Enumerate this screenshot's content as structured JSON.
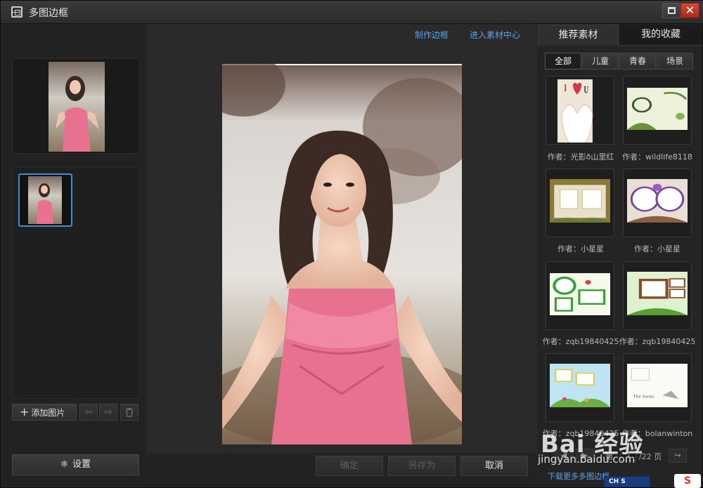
{
  "window": {
    "title": "多图边框",
    "buttons": {
      "maximize": "maximize",
      "close": "✕"
    }
  },
  "left_panel": {
    "add_button": "添加图片",
    "move_left": "⇦",
    "move_right": "⇨",
    "delete": "🗑",
    "settings_button": "设置"
  },
  "center": {
    "links": {
      "make_frame": "制作边框",
      "material_center": "进入素材中心"
    },
    "buttons": {
      "confirm": "确定",
      "save_as": "另存为",
      "cancel": "取消"
    }
  },
  "right_panel": {
    "tabs": [
      "推荐素材",
      "我的收藏"
    ],
    "categories": [
      "全部",
      "儿童",
      "青春",
      "场景"
    ],
    "materials": [
      {
        "author": "作者：光影ð山里红"
      },
      {
        "author": "作者：wildlife8118"
      },
      {
        "author": "作者：小星星"
      },
      {
        "author": "作者：小星星"
      },
      {
        "author": "作者：zqb19840425"
      },
      {
        "author": "作者：zqb19840425"
      },
      {
        "author": "作者：zqb19840425"
      },
      {
        "author": "作者：bolanwinton"
      }
    ],
    "pager": {
      "prefix": "第",
      "current": "1",
      "total": "/22 页"
    },
    "more_link": "下载更多多图边框"
  },
  "watermark": {
    "brand": "Bai 经验",
    "url": "jingyan.baidu.com"
  },
  "ime": {
    "label": "CH S"
  },
  "colors": {
    "accent_blue": "#5ba3e8",
    "dress_pink": "#e8718f",
    "close_red": "#c23a2a"
  }
}
